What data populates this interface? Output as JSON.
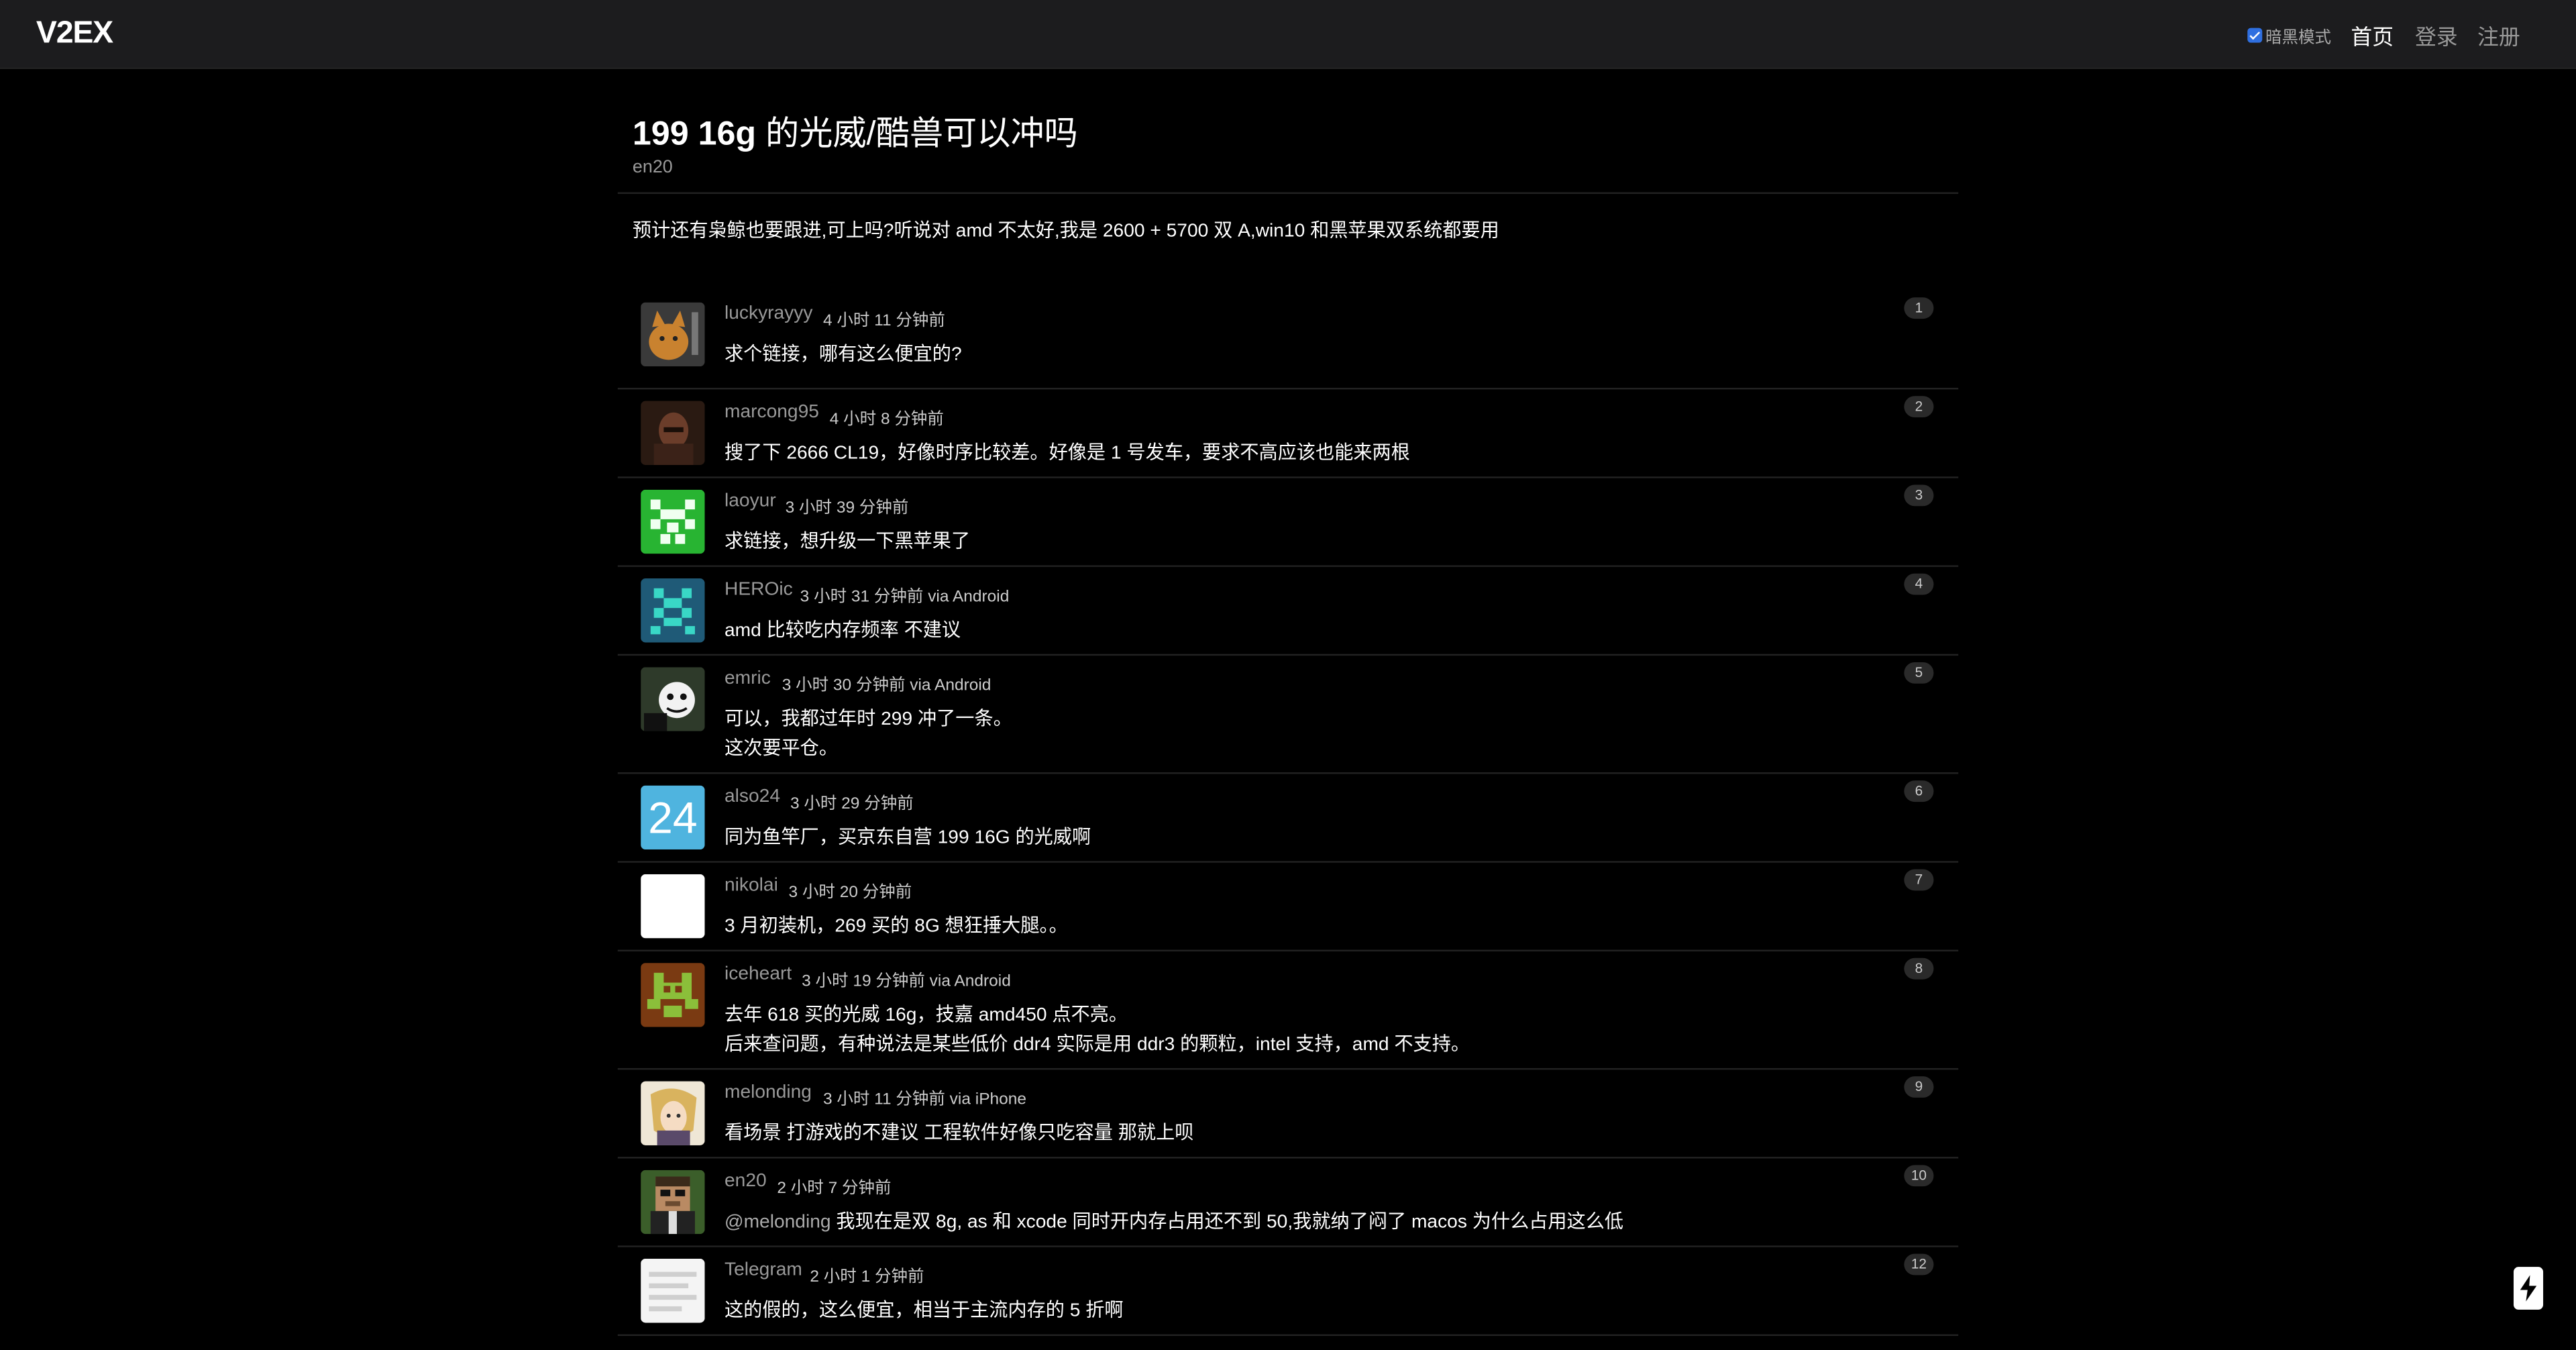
{
  "header": {
    "logo": "V2EX",
    "dark_mode_label": "暗黑模式",
    "dark_mode_checked": true,
    "nav": [
      "首页",
      "登录",
      "注册"
    ]
  },
  "topic": {
    "title_prefix": "199 16g",
    "title_rest": " 的光威/酷兽可以冲吗",
    "author": "en20",
    "content": "预计还有枭鲸也要跟进,可上吗?听说对 amd 不太好,我是 2600 + 5700 双 A,win10 和黑苹果双系统都要用"
  },
  "replies": [
    {
      "user": "luckyrayyy",
      "time": "4 小时 11 分钟前",
      "lines": [
        "求个链接，哪有这么便宜的?"
      ],
      "floor": "1",
      "avatar": "cat-avatar"
    },
    {
      "user": "marcong95",
      "time": "4 小时 8 分钟前",
      "lines": [
        "搜了下 2666 CL19，好像时序比较差。好像是 1 号发车，要求不高应该也能来两根"
      ],
      "floor": "2",
      "avatar": "photo-avatar"
    },
    {
      "user": "laoyur",
      "time": "3 小时 39 分钟前",
      "lines": [
        "求链接，想升级一下黑苹果了"
      ],
      "floor": "3",
      "avatar": "green-pixel-avatar"
    },
    {
      "user": "HEROic",
      "time": "3 小时 31 分钟前 via Android",
      "lines": [
        "amd 比较吃内存频率 不建议"
      ],
      "floor": "4",
      "avatar": "teal-pixel-avatar"
    },
    {
      "user": "emric",
      "time": "3 小时 30 分钟前 via Android",
      "lines": [
        "可以，我都过年时 299 冲了一条。",
        "这次要平仓。"
      ],
      "floor": "5",
      "avatar": "bw-photo-avatar"
    },
    {
      "user": "also24",
      "time": "3 小时 29 分钟前",
      "lines": [
        "同为鱼竿厂，买京东自营 199 16G 的光威啊"
      ],
      "floor": "6",
      "avatar": "number-avatar",
      "avatar_text": "24"
    },
    {
      "user": "nikolai",
      "time": "3 小时 20 分钟前",
      "lines": [
        "3 月初装机，269 买的 8G 想狂捶大腿。。"
      ],
      "floor": "7",
      "avatar": "white-avatar"
    },
    {
      "user": "iceheart",
      "time": "3 小时 19 分钟前 via Android",
      "lines": [
        "去年 618 买的光威 16g，技嘉 amd450 点不亮。",
        "后来查问题，有种说法是某些低价 ddr4 实际是用 ddr3 的颗粒，intel 支持，amd 不支持。"
      ],
      "floor": "8",
      "avatar": "brown-pixel-avatar"
    },
    {
      "user": "melonding",
      "time": "3 小时 11 分钟前 via iPhone",
      "lines": [
        "看场景 打游戏的不建议 工程软件好像只吃容量 那就上呗"
      ],
      "floor": "9",
      "avatar": "anime-avatar"
    },
    {
      "user": "en20",
      "time": "2 小时 7 分钟前",
      "mention": "@melonding",
      "lines": [
        " 我现在是双 8g, as 和 xcode 同时开内存占用还不到 50,我就纳了闷了 macos 为什么占用这么低"
      ],
      "floor": "10",
      "avatar": "minecraft-avatar"
    },
    {
      "user": "Telegram",
      "time": "2 小时 1 分钟前",
      "lines": [
        "这的假的，这么便宜，相当于主流内存的 5 折啊"
      ],
      "floor": "12",
      "avatar": "text-avatar"
    }
  ],
  "colors": {
    "background": "#000000",
    "topbar": "#1c1c1e",
    "divider": "#222222",
    "username": "#999999",
    "checkbox": "#2f6fe0"
  }
}
